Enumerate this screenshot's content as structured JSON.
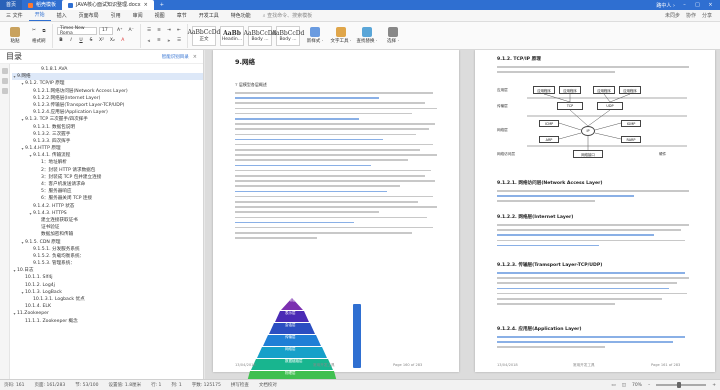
{
  "titlebar": {
    "home_tab": "首页",
    "tabs": [
      {
        "label": "稻壳模板"
      },
      {
        "label": "JAVA核心面试知识整理.docx"
      }
    ],
    "user": "路中人 ›"
  },
  "menubar": {
    "items": [
      "三 文件",
      "开始",
      "插入",
      "页面布局",
      "引用",
      "审阅",
      "视图",
      "章节",
      "开发工具",
      "特色功能"
    ],
    "active_index": 1,
    "search": "查找命令、搜索模板",
    "right_items": [
      "未同步",
      "协作",
      "分享"
    ]
  },
  "ribbon": {
    "paste": "粘贴",
    "format_painter": "格式刷",
    "font_name": "Times New Roma",
    "font_size": "17",
    "styles": [
      {
        "sample": "AaBbCcDd",
        "name": "正文"
      },
      {
        "sample": "AaBb",
        "name": "Headin..."
      },
      {
        "sample": "AaBbCcDd",
        "name": "Body ..."
      },
      {
        "sample": "AaBbCcDd",
        "name": "Body ..."
      }
    ],
    "new_style": "新样式 ·",
    "text_tools": "文字工具 ·",
    "find_replace": "查找替换 ·",
    "select": "选择 ·"
  },
  "nav": {
    "title": "目录",
    "smart": "智能识别目录",
    "items": [
      {
        "text": "9.1.8.1 AVA",
        "depth": 4,
        "caret": ""
      },
      {
        "text": "9.网络",
        "depth": 1,
        "caret": "▾",
        "selected": true
      },
      {
        "text": "9.1.2. TCP/IP 原理",
        "depth": 2,
        "caret": "▾"
      },
      {
        "text": "9.1.2.1.网络访问层(Network Access Layer)",
        "depth": 3,
        "caret": ""
      },
      {
        "text": "9.1.2.2.网络层(Internet Layer)",
        "depth": 3,
        "caret": ""
      },
      {
        "text": "9.1.2.3.传输层(Transport Layer-TCP/UDP)",
        "depth": 3,
        "caret": ""
      },
      {
        "text": "9.1.2.4.应用层(Application Layer)",
        "depth": 3,
        "caret": ""
      },
      {
        "text": "9.1.3. TCP 三次握手/四次挥手",
        "depth": 2,
        "caret": "▾"
      },
      {
        "text": "9.1.3.1. 数据包说明",
        "depth": 3,
        "caret": ""
      },
      {
        "text": "9.1.3.2. 三次握手",
        "depth": 3,
        "caret": ""
      },
      {
        "text": "9.1.3.3. 四次挥手",
        "depth": 3,
        "caret": ""
      },
      {
        "text": "9.1.4.HTTP 原理",
        "depth": 2,
        "caret": "▾"
      },
      {
        "text": "9.1.4.1. 传输流程",
        "depth": 3,
        "caret": "▾"
      },
      {
        "text": "1：地址解析",
        "depth": 4,
        "caret": ""
      },
      {
        "text": "2：封装 HTTP 请求数据包",
        "depth": 4,
        "caret": ""
      },
      {
        "text": "3：封装成 TCP 包并建立连接",
        "depth": 4,
        "caret": ""
      },
      {
        "text": "4：客户机发送请求命",
        "depth": 4,
        "caret": ""
      },
      {
        "text": "5：服务器响应",
        "depth": 4,
        "caret": ""
      },
      {
        "text": "6：服务器关闭 TCP 连接",
        "depth": 4,
        "caret": ""
      },
      {
        "text": "9.1.4.2. HTTP 状态",
        "depth": 3,
        "caret": ""
      },
      {
        "text": "9.1.4.3. HTTPS",
        "depth": 3,
        "caret": "▾"
      },
      {
        "text": "建立连接获取证书",
        "depth": 4,
        "caret": ""
      },
      {
        "text": "证书验证",
        "depth": 4,
        "caret": ""
      },
      {
        "text": "数据加密和传输",
        "depth": 4,
        "caret": ""
      },
      {
        "text": "9.1.5. CDN 原理",
        "depth": 2,
        "caret": "▾"
      },
      {
        "text": "9.1.5.1. 分发服务系统",
        "depth": 3,
        "caret": ""
      },
      {
        "text": "9.1.5.2. 负载均衡系统：",
        "depth": 3,
        "caret": ""
      },
      {
        "text": "9.1.5.3. 管理系统：",
        "depth": 3,
        "caret": ""
      },
      {
        "text": "10.日志",
        "depth": 1,
        "caret": "▾"
      },
      {
        "text": "10.1.1. Slf4j",
        "depth": 2,
        "caret": ""
      },
      {
        "text": "10.1.2. Log4j",
        "depth": 2,
        "caret": ""
      },
      {
        "text": "10.1.3. LogBack",
        "depth": 2,
        "caret": "▾"
      },
      {
        "text": "10.1.3.1. Logback 优点",
        "depth": 3,
        "caret": ""
      },
      {
        "text": "10.1.4. ELK",
        "depth": 2,
        "caret": ""
      },
      {
        "text": "11.Zookeeper",
        "depth": 1,
        "caret": "▾"
      },
      {
        "text": "11.1.1. Zookeeper 概念",
        "depth": 2,
        "caret": ""
      }
    ]
  },
  "page1": {
    "heading": "9.网络",
    "subheading": "7 层模型各层概述",
    "footer_left": "13/04/2018",
    "footer_mid": "常用开发工具",
    "footer_right": "Page 160 of 283",
    "pyramid_labels": [
      "应用层",
      "表示层",
      "会话层",
      "传输层",
      "网络层",
      "数据链路层",
      "物理层"
    ]
  },
  "page2": {
    "heading": "9.1.2. TCP/IP 原理",
    "diagram": {
      "apps": [
        "应用程序",
        "应用程序",
        "应用程序",
        "应用程序"
      ],
      "tcp": "TCP",
      "udp": "UDP",
      "mid": [
        "ICMP",
        "IGMP"
      ],
      "ip": "IP",
      "low": [
        "ARP",
        "RARP"
      ],
      "iface": "网络接口",
      "hw": "硬件",
      "layers": [
        "应用层",
        "传输层",
        "网络层",
        "网络访问层"
      ]
    },
    "sec1": "9.1.2.1. 网络访问层(Network Access Layer)",
    "sec2": "9.1.2.2. 网络层(Internet Layer)",
    "sec3": "9.1.2.3. 传输层(Tramsport Layer-TCP/UDP)",
    "sec4": "9.1.2.4. 应用层(Application Layer)",
    "footer_left": "13/04/2018",
    "footer_mid": "常用开发工具",
    "footer_right": "Page 161 of 283"
  },
  "statusbar": {
    "page": "页码: 161",
    "pages": "页面: 161/283",
    "section": "节: 53/100",
    "setting": "设置值: 1.8厘米",
    "row": "行: 1",
    "col": "列: 1",
    "words": "字数: 125175",
    "spell": "拼写检查",
    "doc_check": "文档校对",
    "zoom": "70%",
    "zoom_fraction": 0.45
  }
}
